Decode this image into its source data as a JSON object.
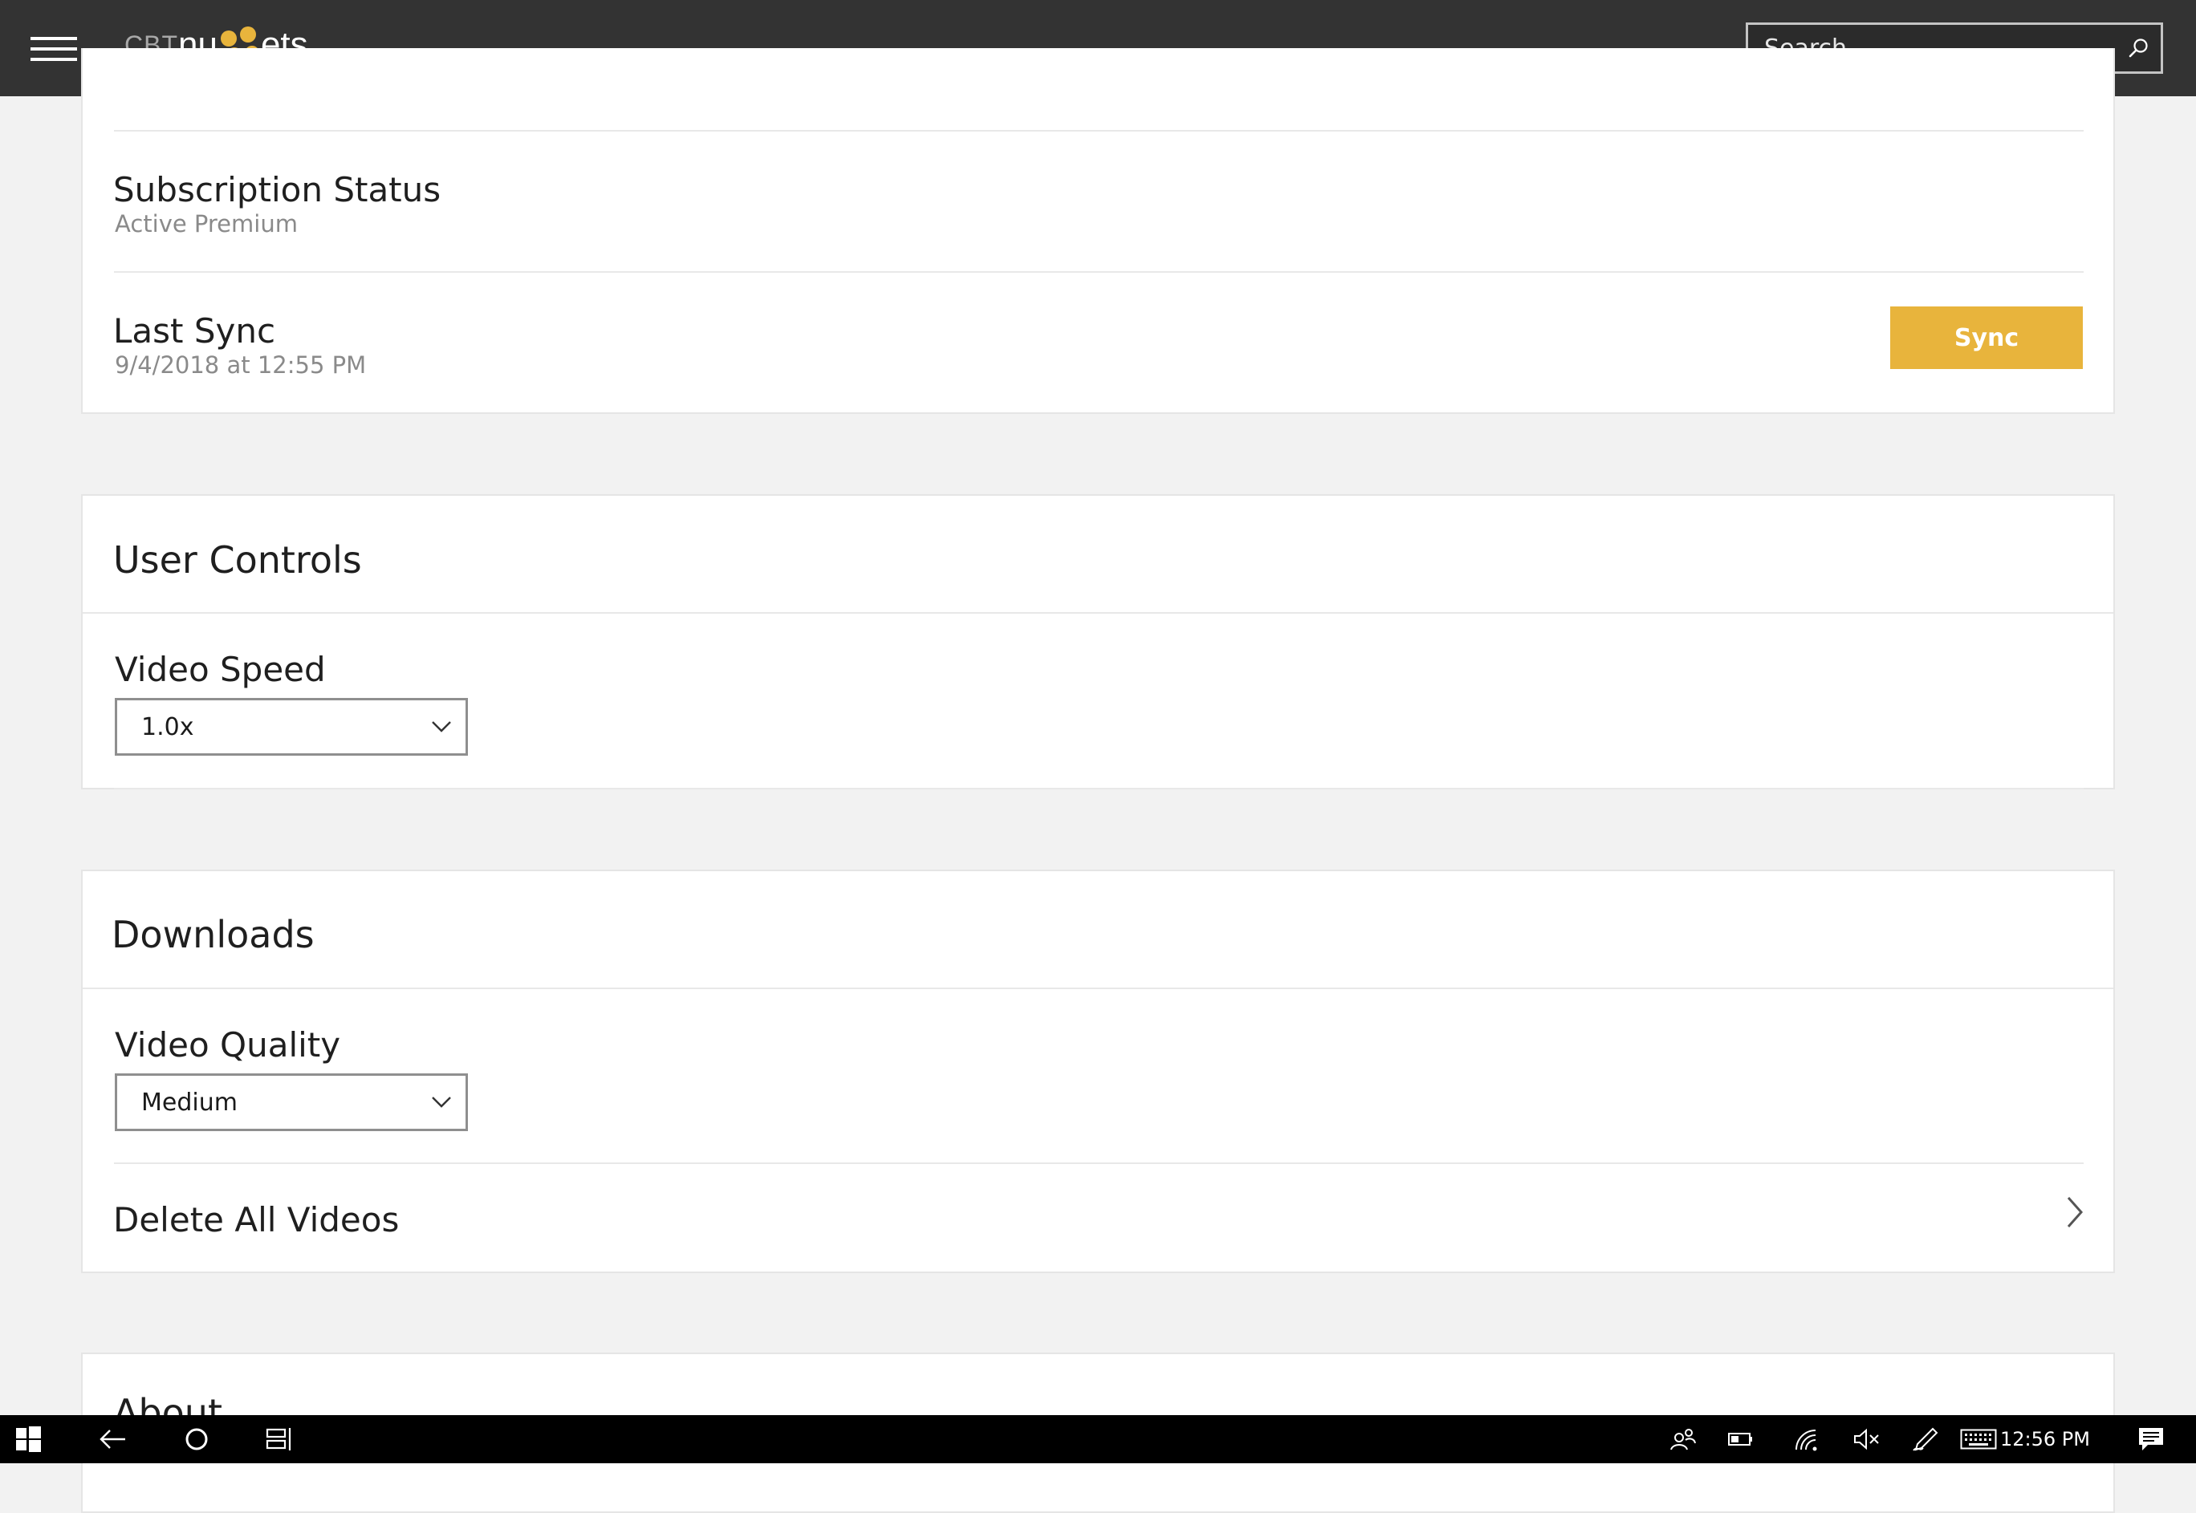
{
  "app": {
    "logo_prefix": "CBT",
    "logo_part1": "nu",
    "logo_part2": "ets",
    "search_placeholder": "Search"
  },
  "account": {
    "subscription_label": "Subscription Status",
    "subscription_value": "Active Premium",
    "last_sync_label": "Last Sync",
    "last_sync_value": "9/4/2018 at 12:55 PM",
    "sync_button": "Sync"
  },
  "user_controls": {
    "heading": "User Controls",
    "video_speed_label": "Video Speed",
    "video_speed_value": "1.0x"
  },
  "downloads": {
    "heading": "Downloads",
    "video_quality_label": "Video Quality",
    "video_quality_value": "Medium",
    "delete_all_label": "Delete All Videos"
  },
  "about": {
    "heading": "About"
  },
  "taskbar": {
    "clock": "12:56 PM"
  },
  "colors": {
    "accent": "#e8b43c",
    "topbar": "#333333",
    "background": "#f2f2f2"
  },
  "icons": {
    "menu": "hamburger-menu-icon",
    "search": "search-icon",
    "dropdown": "chevron-down-icon",
    "row_arrow": "chevron-right-icon",
    "start": "windows-start-icon",
    "back": "back-arrow-icon",
    "cortana": "cortana-circle-icon",
    "task_view": "task-view-icon",
    "people": "people-icon",
    "battery": "battery-icon",
    "network": "network-icon",
    "volume": "volume-muted-icon",
    "pen": "pen-icon",
    "keyboard": "touch-keyboard-icon",
    "action_center": "action-center-icon"
  }
}
